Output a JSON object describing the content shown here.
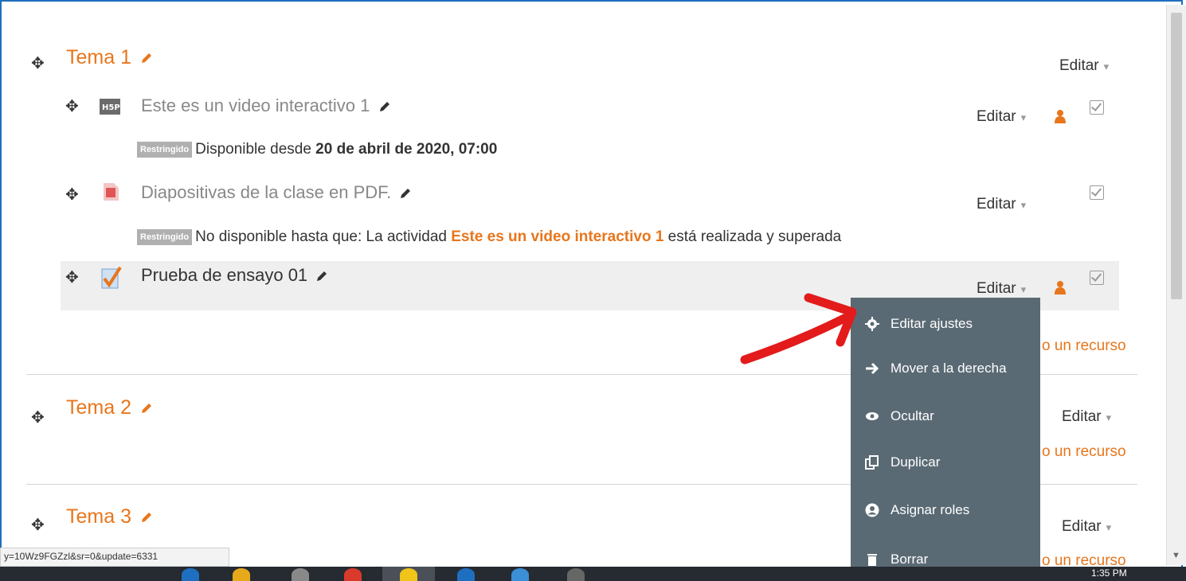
{
  "sections": [
    {
      "title": "Tema 1",
      "edit_label": "Editar"
    },
    {
      "title": "Tema 2",
      "edit_label": "Editar",
      "add_label": "o un recurso"
    },
    {
      "title": "Tema 3",
      "edit_label": "Editar",
      "add_label": "o un recurso"
    }
  ],
  "section1_add_label": "o un recurso",
  "activities": [
    {
      "name": "Este es un video interactivo 1",
      "icon": "h5p-icon",
      "edit_label": "Editar",
      "restriction": {
        "badge": "Restringido",
        "text": "Disponible desde ",
        "bold": "20 de abril de 2020, 07:00"
      }
    },
    {
      "name": "Diapositivas de la clase en PDF.",
      "icon": "pdf-icon",
      "edit_label": "Editar",
      "restriction": {
        "badge": "Restringido",
        "text": "No disponible hasta que: La actividad ",
        "link": "Este es un video interactivo 1",
        "tail": " está realizada y superada"
      }
    },
    {
      "name": "Prueba de ensayo 01",
      "icon": "assignment-icon",
      "edit_label": "Editar"
    }
  ],
  "edit_menu": {
    "items": [
      {
        "label": "Editar ajustes",
        "icon": "gear-icon"
      },
      {
        "label": "Mover a la derecha",
        "icon": "arrow-right-icon"
      },
      {
        "label": "Ocultar",
        "icon": "eye-icon"
      },
      {
        "label": "Duplicar",
        "icon": "duplicate-icon"
      },
      {
        "label": "Asignar roles",
        "icon": "user-circle-icon"
      },
      {
        "label": "Borrar",
        "icon": "trash-icon"
      }
    ]
  },
  "status_bar_url": "y=10Wz9FGZzl&sr=0&update=6331",
  "taskbar": {
    "clock": "1:35 PM"
  },
  "colors": {
    "accent": "#e7761c",
    "menu_bg": "#5a6a74",
    "annotation": "#e31b1b"
  }
}
